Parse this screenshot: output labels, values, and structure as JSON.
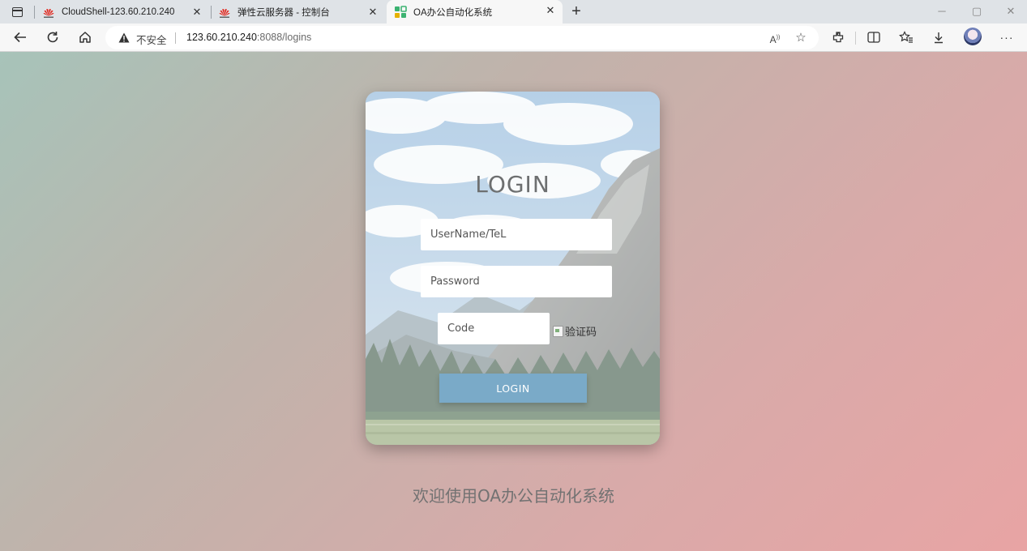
{
  "browser": {
    "tabs": [
      {
        "title": "CloudShell-123.60.210.240",
        "favicon": "huawei-icon",
        "close": "✕"
      },
      {
        "title": "弹性云服务器 - 控制台",
        "favicon": "huawei-icon",
        "close": "✕"
      },
      {
        "title": "OA办公自动化系统",
        "favicon": "app-grid-icon",
        "close": "✕",
        "active": true
      }
    ],
    "new_tab": "+",
    "address": {
      "security_label": "不安全",
      "host": "123.60.210.240",
      "rest": ":8088/logins"
    },
    "window_controls": {
      "minimize": "─",
      "maximize": "▢",
      "close": "✕"
    }
  },
  "login": {
    "title": "LOGIN",
    "username_placeholder": "UserName/TeL",
    "password_placeholder": "Password",
    "code_placeholder": "Code",
    "captcha_alt": "验证码",
    "button_label": "LOGIN"
  },
  "footer": {
    "welcome": "欢迎使用OA办公自动化系统"
  },
  "colors": {
    "button": "#7aaac8",
    "huawei_red": "#e1251b",
    "app_icon_green": "#3cb371"
  }
}
